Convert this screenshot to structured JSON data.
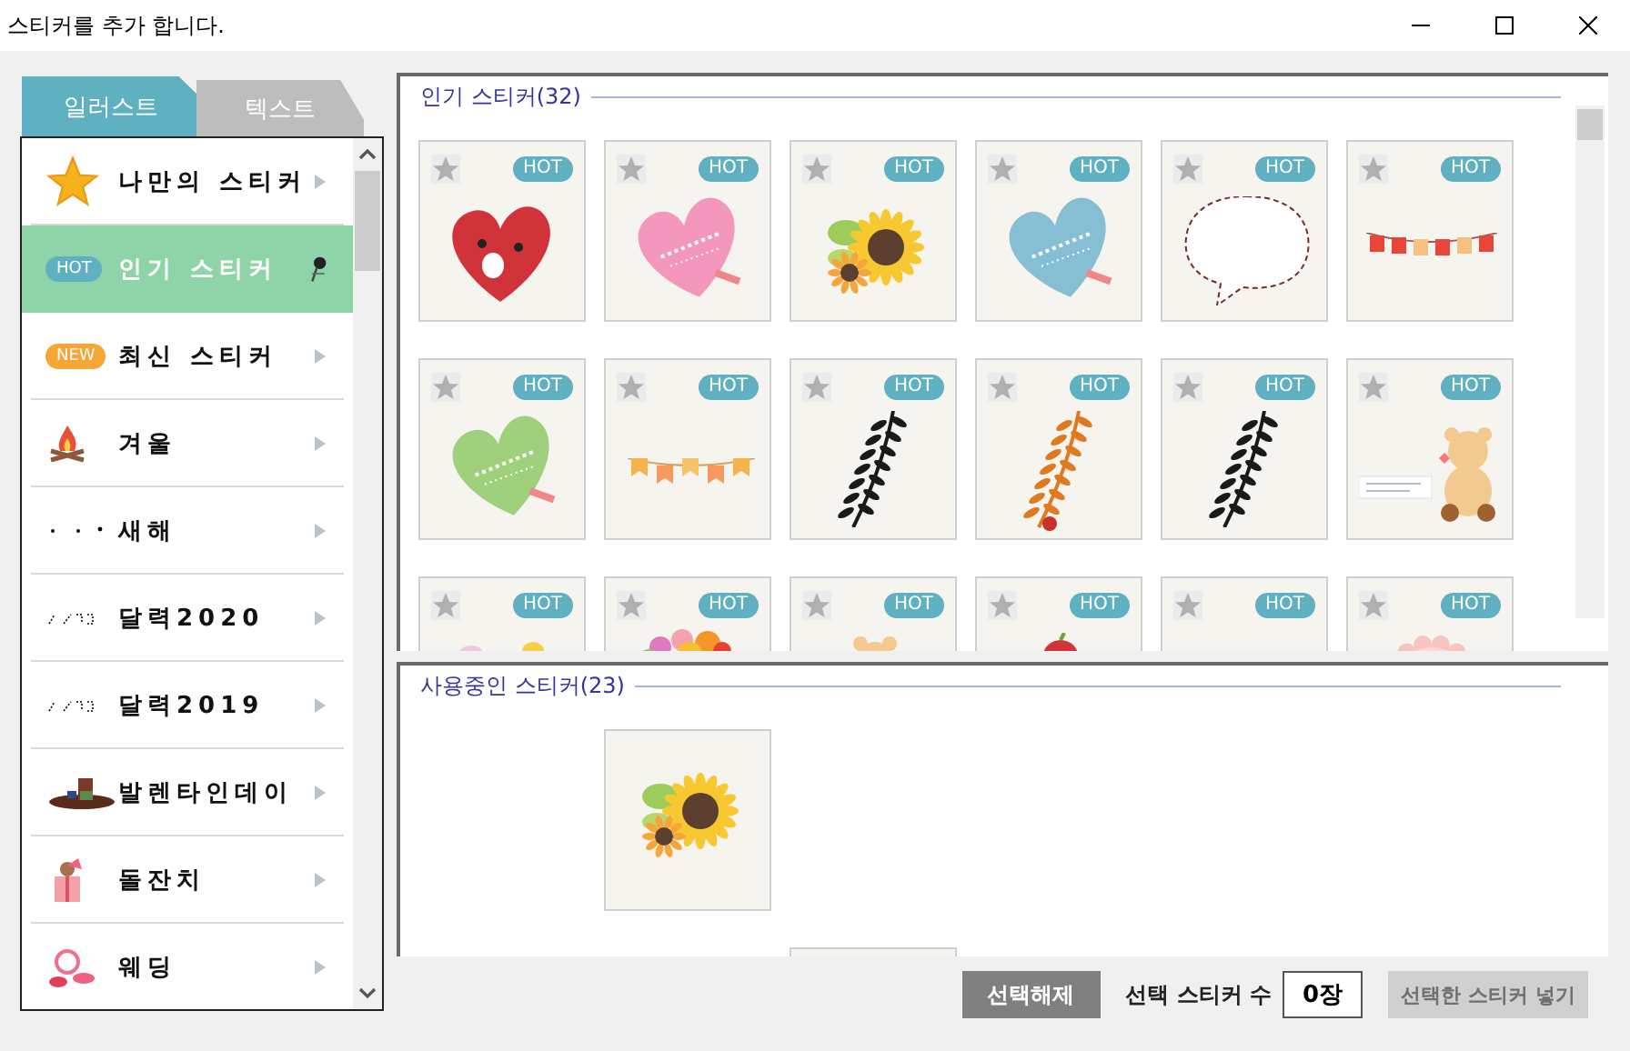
{
  "window": {
    "title": "스티커를 추가 합니다."
  },
  "tabs": [
    {
      "label": "일러스트",
      "selected": true
    },
    {
      "label": "텍스트",
      "selected": false
    }
  ],
  "categories": [
    {
      "kind": "star",
      "label": "나만의 스티커",
      "selected": false
    },
    {
      "kind": "badge",
      "badge": "HOT",
      "color": "#5fb0c0",
      "label": "인기 스티커",
      "selected": true
    },
    {
      "kind": "badge",
      "badge": "NEW",
      "color": "#f7a535",
      "label": "최신 스티커",
      "selected": false
    },
    {
      "kind": "fire",
      "label": "겨울",
      "selected": false
    },
    {
      "kind": "dots",
      "label": "새해",
      "selected": false
    },
    {
      "kind": "scribble",
      "label": "달력2020",
      "selected": false
    },
    {
      "kind": "scribble",
      "label": "달력2019",
      "selected": false
    },
    {
      "kind": "box",
      "label": "발렌타인데이",
      "selected": false
    },
    {
      "kind": "gift",
      "label": "돌잔치",
      "selected": false
    },
    {
      "kind": "flower",
      "label": "웨딩",
      "selected": false
    }
  ],
  "popular": {
    "title": "인기 스티커(32)",
    "stickers": [
      {
        "kind": "heart-face",
        "badge": "HOT"
      },
      {
        "kind": "heart-love",
        "color": "#f497bd",
        "badge": "HOT"
      },
      {
        "kind": "sunflower",
        "badge": "HOT"
      },
      {
        "kind": "heart-love",
        "color": "#86bfd3",
        "badge": "HOT"
      },
      {
        "kind": "bubble",
        "badge": "HOT"
      },
      {
        "kind": "bunting",
        "badge": "HOT"
      },
      {
        "kind": "heart-love",
        "color": "#9fd07c",
        "badge": "HOT"
      },
      {
        "kind": "flags",
        "badge": "HOT"
      },
      {
        "kind": "branch",
        "badge": "HOT"
      },
      {
        "kind": "twig",
        "badge": "HOT"
      },
      {
        "kind": "branch",
        "badge": "HOT"
      },
      {
        "kind": "bear",
        "badge": "HOT"
      },
      {
        "kind": "dots",
        "badge": "HOT"
      },
      {
        "kind": "bouquet",
        "badge": "HOT"
      },
      {
        "kind": "bear-head",
        "badge": "HOT"
      },
      {
        "kind": "apple",
        "badge": "HOT"
      },
      {
        "kind": "blank",
        "badge": "HOT"
      },
      {
        "kind": "lace",
        "badge": "HOT"
      }
    ]
  },
  "in_use": {
    "title": "사용중인 스티커(23)",
    "stickers": [
      {
        "kind": "sunflower"
      },
      {
        "kind": "blank"
      }
    ]
  },
  "footer": {
    "clear_button": "선택해제",
    "count_label": "선택 스티커 수",
    "count_value": "0장",
    "insert_button": {
      "label": "선택한 스티커 넣기",
      "disabled": true
    }
  }
}
